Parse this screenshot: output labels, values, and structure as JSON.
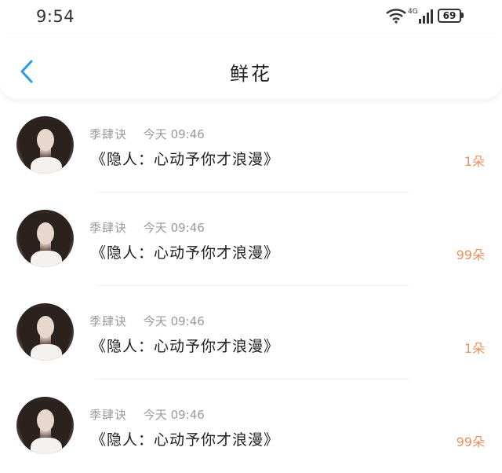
{
  "status_bar": {
    "time": "9:54",
    "network_label": "4G",
    "battery": "69"
  },
  "header": {
    "title": "鲜花"
  },
  "gifts": [
    {
      "sender": "季肆诀",
      "date": "今天",
      "time": "09:46",
      "text": "《隐人：心动予你才浪漫》",
      "count": "1朵"
    },
    {
      "sender": "季肆诀",
      "date": "今天",
      "time": "09:46",
      "text": "《隐人：心动予你才浪漫》",
      "count": "99朵"
    },
    {
      "sender": "季肆诀",
      "date": "今天",
      "time": "09:46",
      "text": "《隐人：心动予你才浪漫》",
      "count": "1朵"
    },
    {
      "sender": "季肆诀",
      "date": "今天",
      "time": "09:46",
      "text": "《隐人：心动予你才浪漫》",
      "count": "99朵"
    }
  ],
  "colors": {
    "accent_back": "#2a9de6",
    "count_text": "#e8915a"
  }
}
